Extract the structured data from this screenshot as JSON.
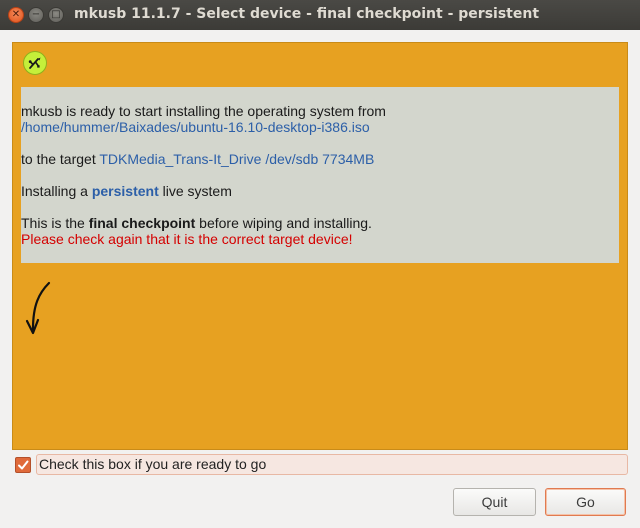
{
  "window": {
    "title": "mkusb 11.1.7 - Select device - final checkpoint - persistent",
    "close_glyph": "✕",
    "min_glyph": "−",
    "max_glyph": "□"
  },
  "panel": {
    "bg_color": "#e7a121",
    "app_icon": "mkusb-usb-icon",
    "info": {
      "line1": "mkusb is ready to start installing the operating system from",
      "iso_path": "/home/hummer/Baixades/ubuntu-16.10-desktop-i386.iso",
      "target_prefix": "to the target ",
      "target_device": "TDKMedia_Trans-It_Drive /dev/sdb 7734MB",
      "install_prefix": "Installing a ",
      "install_mode": "persistent",
      "install_suffix": " live system",
      "checkpoint_prefix": "This is the ",
      "checkpoint_bold": "final checkpoint",
      "checkpoint_suffix": " before wiping and installing.",
      "warning": "Please check again that it is the correct target device!"
    },
    "arrow_icon": "curved-arrow-down-icon"
  },
  "confirm": {
    "checked": true,
    "label": "Check this box if you are ready to go"
  },
  "buttons": {
    "quit": "Quit",
    "go": "Go"
  }
}
